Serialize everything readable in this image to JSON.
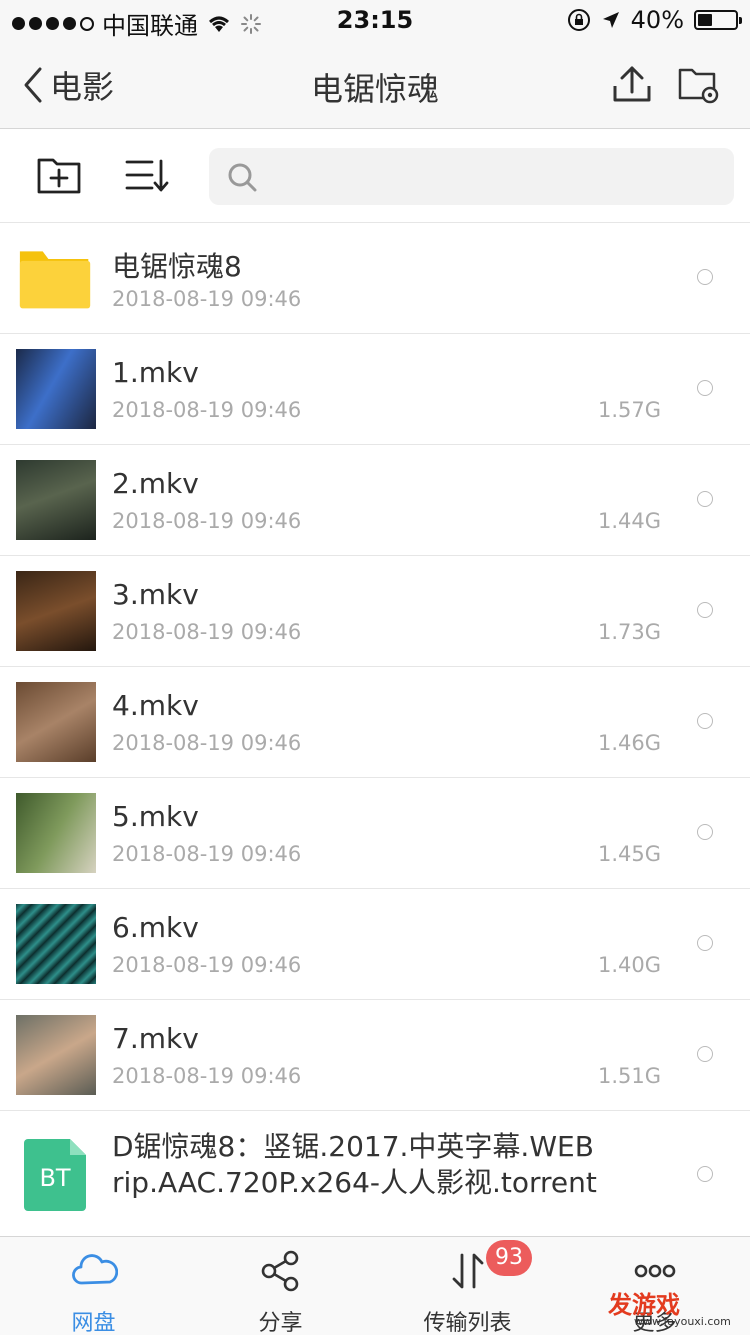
{
  "status_bar": {
    "carrier": "中国联通",
    "time": "23:15",
    "battery": "40%",
    "battery_level": 0.4
  },
  "nav": {
    "back_label": "电影",
    "title": "电锯惊魂"
  },
  "search": {
    "placeholder": ""
  },
  "files": [
    {
      "name": "电锯惊魂8",
      "date": "2018-08-19 09:46",
      "size": "",
      "kind": "folder"
    },
    {
      "name": "1.mkv",
      "date": "2018-08-19 09:46",
      "size": "1.57G",
      "kind": "video"
    },
    {
      "name": "2.mkv",
      "date": "2018-08-19 09:46",
      "size": "1.44G",
      "kind": "video"
    },
    {
      "name": "3.mkv",
      "date": "2018-08-19 09:46",
      "size": "1.73G",
      "kind": "video"
    },
    {
      "name": "4.mkv",
      "date": "2018-08-19 09:46",
      "size": "1.46G",
      "kind": "video"
    },
    {
      "name": "5.mkv",
      "date": "2018-08-19 09:46",
      "size": "1.45G",
      "kind": "video"
    },
    {
      "name": "6.mkv",
      "date": "2018-08-19 09:46",
      "size": "1.40G",
      "kind": "video"
    },
    {
      "name": "7.mkv",
      "date": "2018-08-19 09:46",
      "size": "1.51G",
      "kind": "video"
    },
    {
      "name": "D锯惊魂8：竖锯.2017.中英字幕.WEBrip.AAC.720P.x264-人人影视.torrent",
      "kind": "torrent",
      "icon_text": "BT"
    }
  ],
  "tabs": [
    {
      "label": "网盘",
      "icon": "cloud-icon",
      "active": true
    },
    {
      "label": "分享",
      "icon": "share-icon"
    },
    {
      "label": "传输列表",
      "icon": "transfer-icon"
    },
    {
      "label": "更多",
      "icon": "more-icon"
    }
  ],
  "transfer_badge": "93",
  "watermark": {
    "main": "发游戏",
    "sub": "www.fayouxi.com"
  },
  "colors": {
    "accent": "#3b8ee4",
    "badge": "#ec5c5c",
    "folder": "#fcd23b",
    "bt": "#3ec18e"
  }
}
